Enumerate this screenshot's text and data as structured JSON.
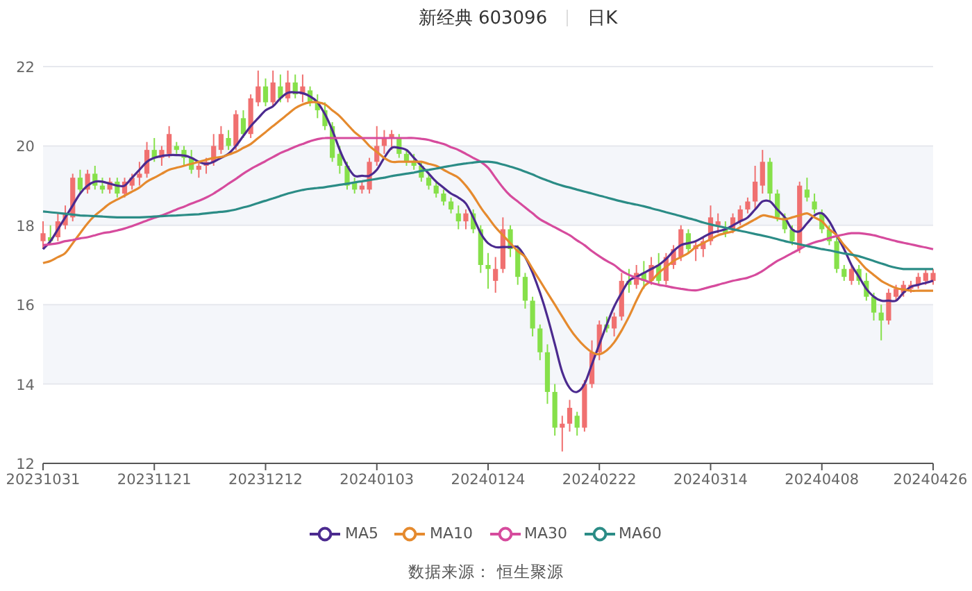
{
  "header": {
    "title": "新经典 603096",
    "period": "日K"
  },
  "chart": {
    "chart_data": {
      "type": "candlestick",
      "categories": [
        "20231031",
        null,
        null,
        null,
        null,
        null,
        null,
        null,
        null,
        null,
        null,
        null,
        null,
        null,
        null,
        "20231121",
        null,
        null,
        null,
        null,
        null,
        null,
        null,
        null,
        null,
        null,
        null,
        null,
        null,
        null,
        "20231212",
        null,
        null,
        null,
        null,
        null,
        null,
        null,
        null,
        null,
        null,
        null,
        null,
        null,
        null,
        "20240103",
        null,
        null,
        null,
        null,
        null,
        null,
        null,
        null,
        null,
        null,
        null,
        null,
        null,
        null,
        "20240124",
        null,
        null,
        null,
        null,
        null,
        null,
        null,
        null,
        null,
        null,
        null,
        null,
        null,
        null,
        "20240222",
        null,
        null,
        null,
        null,
        null,
        null,
        null,
        null,
        null,
        null,
        null,
        null,
        null,
        null,
        "20240314",
        null,
        null,
        null,
        null,
        null,
        null,
        null,
        null,
        null,
        null,
        null,
        null,
        null,
        null,
        "20240408",
        null,
        null,
        null,
        null,
        null,
        null,
        null,
        null,
        null,
        null,
        null,
        null,
        null,
        null,
        "20240426"
      ],
      "ohlc": [
        [
          17.6,
          18.1,
          17.4,
          17.8
        ],
        [
          17.7,
          18.0,
          17.5,
          17.6
        ],
        [
          17.7,
          18.3,
          17.6,
          18.1
        ],
        [
          18.0,
          18.5,
          17.9,
          18.3
        ],
        [
          18.2,
          19.3,
          18.1,
          19.2
        ],
        [
          19.2,
          19.4,
          18.8,
          18.9
        ],
        [
          18.9,
          19.4,
          18.8,
          19.3
        ],
        [
          19.3,
          19.5,
          18.9,
          19.0
        ],
        [
          19.0,
          19.2,
          18.8,
          18.9
        ],
        [
          18.9,
          19.2,
          18.8,
          19.1
        ],
        [
          19.1,
          19.2,
          18.7,
          18.8
        ],
        [
          18.8,
          19.2,
          18.7,
          19.1
        ],
        [
          19.0,
          19.3,
          18.9,
          19.2
        ],
        [
          19.2,
          19.6,
          19.0,
          19.3
        ],
        [
          19.3,
          20.1,
          19.2,
          19.9
        ],
        [
          19.9,
          20.2,
          19.6,
          19.7
        ],
        [
          19.7,
          20.0,
          19.5,
          19.9
        ],
        [
          19.8,
          20.5,
          19.7,
          20.3
        ],
        [
          20.0,
          20.1,
          19.8,
          19.9
        ],
        [
          19.9,
          20.0,
          19.5,
          19.7
        ],
        [
          19.7,
          19.9,
          19.3,
          19.4
        ],
        [
          19.4,
          19.6,
          19.2,
          19.5
        ],
        [
          19.5,
          19.7,
          19.3,
          19.6
        ],
        [
          19.6,
          20.3,
          19.5,
          20.0
        ],
        [
          19.9,
          20.5,
          19.8,
          20.3
        ],
        [
          20.2,
          20.4,
          19.9,
          20.0
        ],
        [
          20.0,
          20.9,
          19.9,
          20.8
        ],
        [
          20.7,
          20.9,
          20.2,
          20.3
        ],
        [
          20.3,
          21.3,
          20.2,
          21.2
        ],
        [
          21.1,
          21.9,
          21.0,
          21.5
        ],
        [
          21.5,
          21.7,
          21.0,
          21.1
        ],
        [
          21.1,
          21.9,
          21.0,
          21.6
        ],
        [
          21.5,
          21.8,
          21.1,
          21.2
        ],
        [
          21.2,
          21.9,
          21.1,
          21.6
        ],
        [
          21.6,
          21.8,
          21.2,
          21.3
        ],
        [
          21.3,
          21.8,
          21.1,
          21.5
        ],
        [
          21.4,
          21.5,
          21.0,
          21.1
        ],
        [
          21.1,
          21.3,
          20.7,
          20.9
        ],
        [
          20.9,
          21.1,
          20.4,
          20.5
        ],
        [
          20.5,
          20.6,
          19.6,
          19.7
        ],
        [
          19.8,
          20.0,
          19.3,
          19.5
        ],
        [
          19.5,
          19.6,
          18.9,
          19.0
        ],
        [
          19.1,
          19.2,
          18.8,
          18.9
        ],
        [
          18.9,
          19.1,
          18.8,
          19.0
        ],
        [
          18.9,
          19.7,
          18.8,
          19.6
        ],
        [
          19.6,
          20.5,
          19.5,
          20.0
        ],
        [
          20.0,
          20.4,
          19.8,
          20.2
        ],
        [
          20.2,
          20.4,
          19.9,
          20.3
        ],
        [
          20.2,
          20.3,
          19.7,
          19.8
        ],
        [
          19.8,
          19.9,
          19.5,
          19.6
        ],
        [
          19.6,
          19.8,
          19.4,
          19.5
        ],
        [
          19.5,
          19.6,
          19.1,
          19.2
        ],
        [
          19.2,
          19.3,
          18.9,
          19.0
        ],
        [
          19.0,
          19.1,
          18.7,
          18.8
        ],
        [
          18.8,
          18.9,
          18.5,
          18.6
        ],
        [
          18.6,
          18.7,
          18.3,
          18.4
        ],
        [
          18.3,
          18.5,
          17.9,
          18.1
        ],
        [
          18.1,
          18.4,
          17.9,
          18.3
        ],
        [
          18.3,
          18.4,
          17.8,
          17.9
        ],
        [
          17.9,
          18.0,
          16.8,
          17.0
        ],
        [
          17.0,
          17.3,
          16.4,
          16.9
        ],
        [
          16.6,
          17.2,
          16.3,
          16.9
        ],
        [
          16.9,
          18.2,
          16.8,
          17.9
        ],
        [
          17.9,
          18.0,
          17.2,
          17.4
        ],
        [
          17.4,
          17.5,
          16.5,
          16.7
        ],
        [
          16.7,
          16.8,
          15.9,
          16.1
        ],
        [
          16.1,
          16.2,
          15.2,
          15.4
        ],
        [
          15.4,
          15.5,
          14.6,
          14.8
        ],
        [
          14.8,
          15.0,
          13.5,
          13.8
        ],
        [
          13.8,
          14.0,
          12.7,
          12.9
        ],
        [
          12.9,
          13.2,
          12.3,
          13.0
        ],
        [
          13.0,
          13.6,
          12.8,
          13.4
        ],
        [
          13.2,
          13.3,
          12.7,
          12.9
        ],
        [
          12.9,
          14.1,
          12.8,
          14.0
        ],
        [
          14.0,
          15.1,
          13.9,
          14.8
        ],
        [
          14.8,
          15.6,
          14.6,
          15.5
        ],
        [
          15.5,
          15.7,
          15.3,
          15.4
        ],
        [
          15.4,
          15.8,
          15.2,
          15.7
        ],
        [
          15.7,
          16.8,
          15.6,
          16.6
        ],
        [
          16.6,
          16.9,
          16.3,
          16.5
        ],
        [
          16.5,
          17.0,
          16.4,
          16.8
        ],
        [
          16.8,
          17.1,
          16.4,
          16.6
        ],
        [
          16.6,
          17.2,
          16.5,
          17.0
        ],
        [
          17.0,
          17.3,
          16.5,
          16.6
        ],
        [
          16.6,
          17.3,
          16.5,
          17.2
        ],
        [
          17.0,
          17.5,
          16.9,
          17.4
        ],
        [
          17.2,
          18.0,
          17.1,
          17.9
        ],
        [
          17.8,
          17.9,
          17.3,
          17.4
        ],
        [
          17.4,
          17.6,
          17.1,
          17.5
        ],
        [
          17.4,
          17.7,
          17.2,
          17.6
        ],
        [
          17.6,
          18.5,
          17.5,
          18.2
        ],
        [
          18.0,
          18.3,
          17.8,
          18.1
        ],
        [
          17.9,
          18.1,
          17.7,
          17.8
        ],
        [
          17.9,
          18.3,
          17.8,
          18.2
        ],
        [
          18.1,
          18.5,
          18.0,
          18.4
        ],
        [
          18.4,
          18.7,
          18.3,
          18.6
        ],
        [
          18.6,
          19.5,
          18.4,
          19.1
        ],
        [
          19.0,
          19.9,
          18.8,
          19.6
        ],
        [
          19.6,
          19.7,
          18.6,
          18.8
        ],
        [
          18.8,
          18.9,
          18.1,
          18.2
        ],
        [
          18.2,
          18.3,
          17.8,
          17.9
        ],
        [
          17.9,
          18.0,
          17.5,
          17.6
        ],
        [
          17.4,
          19.1,
          17.3,
          19.0
        ],
        [
          18.9,
          19.2,
          18.6,
          18.7
        ],
        [
          18.6,
          18.8,
          18.3,
          18.4
        ],
        [
          18.3,
          18.4,
          17.8,
          17.9
        ],
        [
          17.9,
          18.0,
          17.5,
          17.6
        ],
        [
          17.6,
          17.7,
          16.8,
          16.9
        ],
        [
          16.9,
          17.0,
          16.6,
          16.7
        ],
        [
          16.6,
          17.0,
          16.5,
          16.9
        ],
        [
          16.9,
          17.0,
          16.5,
          16.6
        ],
        [
          16.6,
          16.8,
          16.1,
          16.2
        ],
        [
          16.2,
          16.3,
          15.6,
          15.8
        ],
        [
          15.8,
          16.0,
          15.1,
          15.6
        ],
        [
          15.6,
          16.4,
          15.5,
          16.3
        ],
        [
          16.2,
          16.5,
          16.1,
          16.4
        ],
        [
          16.3,
          16.6,
          16.2,
          16.5
        ],
        [
          16.4,
          16.6,
          16.3,
          16.5
        ],
        [
          16.5,
          16.8,
          16.4,
          16.7
        ],
        [
          16.6,
          16.9,
          16.5,
          16.8
        ],
        [
          16.6,
          16.9,
          16.5,
          16.8
        ]
      ],
      "series": [
        {
          "name": "MA5",
          "type": "line",
          "color": "#4b2a8f",
          "values": [
            17.4,
            17.6,
            17.9,
            18.2,
            18.5,
            18.8,
            19.0,
            19.1,
            19.1,
            19.05,
            19.0,
            19.0,
            19.2,
            19.4,
            19.6,
            19.7,
            19.75,
            19.77,
            19.77,
            19.76,
            19.7,
            19.6,
            19.55,
            19.6,
            19.7,
            19.8,
            20.0,
            20.25,
            20.5,
            20.7,
            20.9,
            21.0,
            21.2,
            21.34,
            21.35,
            21.33,
            21.25,
            21.1,
            20.8,
            20.4,
            19.9,
            19.5,
            19.25,
            19.25,
            19.25,
            19.4,
            19.7,
            19.95,
            19.95,
            19.9,
            19.7,
            19.5,
            19.3,
            19.1,
            18.95,
            18.8,
            18.7,
            18.55,
            18.2,
            17.8,
            17.55,
            17.45,
            17.45,
            17.45,
            17.45,
            17.2,
            16.8,
            16.3,
            15.7,
            15.0,
            14.3,
            13.9,
            13.8,
            14.0,
            14.5,
            15.0,
            15.5,
            15.95,
            16.3,
            16.6,
            16.7,
            16.8,
            16.9,
            17.0,
            17.15,
            17.35,
            17.5,
            17.55,
            17.6,
            17.7,
            17.8,
            17.85,
            17.9,
            18.0,
            18.1,
            18.2,
            18.4,
            18.6,
            18.6,
            18.4,
            18.2,
            17.9,
            17.85,
            18.05,
            18.25,
            18.3,
            18.1,
            17.75,
            17.4,
            17.0,
            16.7,
            16.4,
            16.2,
            16.1,
            16.1,
            16.1,
            16.3,
            16.45,
            16.5,
            16.55,
            16.6
          ]
        },
        {
          "name": "MA10",
          "type": "line",
          "color": "#e58a2e",
          "values": [
            17.05,
            17.1,
            17.2,
            17.3,
            17.55,
            17.8,
            18.05,
            18.25,
            18.4,
            18.55,
            18.65,
            18.75,
            18.85,
            18.95,
            19.1,
            19.2,
            19.3,
            19.4,
            19.45,
            19.5,
            19.55,
            19.6,
            19.65,
            19.7,
            19.72,
            19.78,
            19.85,
            19.95,
            20.05,
            20.2,
            20.35,
            20.5,
            20.65,
            20.8,
            20.95,
            21.05,
            21.1,
            21.1,
            21.05,
            20.9,
            20.75,
            20.55,
            20.35,
            20.2,
            20.0,
            19.85,
            19.7,
            19.6,
            19.6,
            19.6,
            19.6,
            19.6,
            19.55,
            19.5,
            19.4,
            19.3,
            19.2,
            19.0,
            18.75,
            18.45,
            18.2,
            17.95,
            17.75,
            17.55,
            17.35,
            17.2,
            16.9,
            16.6,
            16.3,
            16.0,
            15.7,
            15.4,
            15.15,
            14.95,
            14.8,
            14.75,
            14.85,
            15.05,
            15.35,
            15.7,
            16.1,
            16.45,
            16.6,
            16.8,
            16.95,
            17.1,
            17.2,
            17.3,
            17.45,
            17.55,
            17.65,
            17.75,
            17.8,
            17.85,
            17.95,
            18.05,
            18.15,
            18.25,
            18.22,
            18.18,
            18.15,
            18.2,
            18.25,
            18.3,
            18.2,
            18.1,
            17.9,
            17.75,
            17.5,
            17.3,
            17.1,
            16.9,
            16.75,
            16.6,
            16.5,
            16.42,
            16.38,
            16.35,
            16.35,
            16.35,
            16.35
          ]
        },
        {
          "name": "MA30",
          "type": "line",
          "color": "#d64b9d",
          "values": [
            17.5,
            17.52,
            17.55,
            17.6,
            17.63,
            17.67,
            17.7,
            17.75,
            17.8,
            17.83,
            17.87,
            17.92,
            17.98,
            18.05,
            18.12,
            18.19,
            18.25,
            18.32,
            18.4,
            18.47,
            18.55,
            18.62,
            18.7,
            18.8,
            18.92,
            19.05,
            19.17,
            19.3,
            19.42,
            19.52,
            19.62,
            19.72,
            19.82,
            19.9,
            19.98,
            20.05,
            20.12,
            20.17,
            20.2,
            20.2,
            20.2,
            20.2,
            20.2,
            20.2,
            20.2,
            20.2,
            20.2,
            20.2,
            20.2,
            20.2,
            20.2,
            20.18,
            20.15,
            20.1,
            20.05,
            19.97,
            19.9,
            19.8,
            19.7,
            19.6,
            19.45,
            19.2,
            18.95,
            18.75,
            18.6,
            18.45,
            18.3,
            18.15,
            18.05,
            17.95,
            17.85,
            17.75,
            17.62,
            17.5,
            17.35,
            17.22,
            17.1,
            17.0,
            16.85,
            16.75,
            16.68,
            16.62,
            16.55,
            16.5,
            16.47,
            16.43,
            16.4,
            16.37,
            16.36,
            16.4,
            16.45,
            16.5,
            16.55,
            16.6,
            16.64,
            16.68,
            16.75,
            16.85,
            16.98,
            17.1,
            17.2,
            17.3,
            17.4,
            17.5,
            17.57,
            17.62,
            17.68,
            17.73,
            17.77,
            17.8,
            17.8,
            17.78,
            17.75,
            17.7,
            17.65,
            17.6,
            17.56,
            17.52,
            17.48,
            17.44,
            17.4
          ]
        },
        {
          "name": "MA60",
          "type": "line",
          "color": "#2b8c86",
          "values": [
            18.35,
            18.33,
            18.31,
            18.29,
            18.27,
            18.25,
            18.24,
            18.23,
            18.22,
            18.21,
            18.2,
            18.2,
            18.2,
            18.2,
            18.21,
            18.22,
            18.23,
            18.24,
            18.25,
            18.26,
            18.27,
            18.28,
            18.3,
            18.32,
            18.34,
            18.36,
            18.4,
            18.45,
            18.5,
            18.56,
            18.62,
            18.68,
            18.74,
            18.8,
            18.85,
            18.89,
            18.92,
            18.94,
            18.96,
            18.99,
            19.02,
            19.05,
            19.08,
            19.11,
            19.14,
            19.17,
            19.2,
            19.24,
            19.27,
            19.3,
            19.33,
            19.37,
            19.4,
            19.43,
            19.47,
            19.5,
            19.53,
            19.56,
            19.58,
            19.6,
            19.6,
            19.58,
            19.53,
            19.48,
            19.42,
            19.35,
            19.28,
            19.2,
            19.13,
            19.06,
            19.0,
            18.95,
            18.9,
            18.85,
            18.8,
            18.75,
            18.7,
            18.65,
            18.6,
            18.56,
            18.52,
            18.48,
            18.43,
            18.38,
            18.33,
            18.28,
            18.23,
            18.18,
            18.13,
            18.07,
            18.02,
            17.98,
            17.94,
            17.9,
            17.86,
            17.82,
            17.78,
            17.74,
            17.7,
            17.65,
            17.6,
            17.56,
            17.52,
            17.48,
            17.44,
            17.4,
            17.37,
            17.33,
            17.29,
            17.26,
            17.22,
            17.16,
            17.1,
            17.04,
            16.98,
            16.93,
            16.9,
            16.9,
            16.9,
            16.9,
            16.9
          ]
        }
      ],
      "ylim": [
        12,
        22
      ],
      "yticks": [
        12,
        14,
        16,
        18,
        20,
        22
      ],
      "grid": true
    }
  },
  "footer": {
    "source": "数据来源： 恒生聚源"
  }
}
